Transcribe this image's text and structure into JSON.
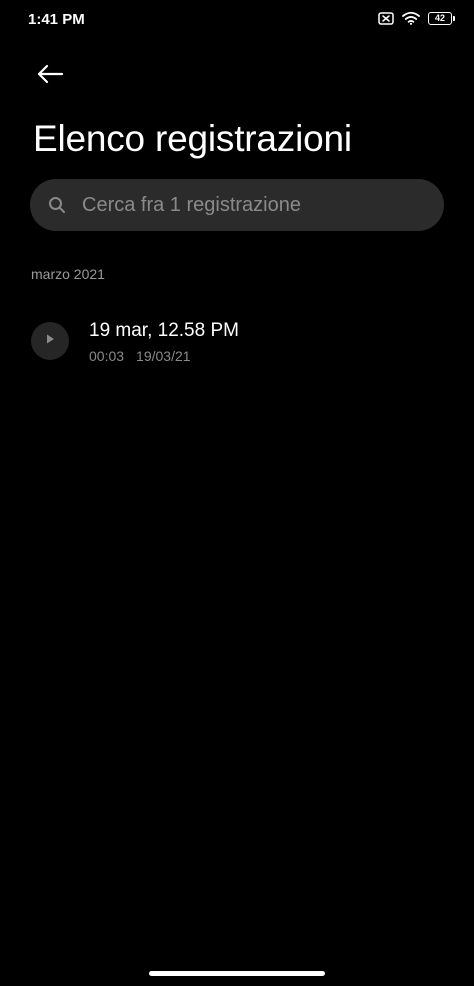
{
  "status_bar": {
    "time": "1:41 PM",
    "battery_level": "42",
    "icons": [
      "sim-disabled-icon",
      "wifi-icon",
      "battery-icon"
    ]
  },
  "header": {
    "back_icon": "arrow-left-icon",
    "title": "Elenco registrazioni"
  },
  "search": {
    "placeholder": "Cerca fra 1 registrazione",
    "value": "",
    "icon": "search-icon"
  },
  "sections": [
    {
      "header": "marzo 2021",
      "items": [
        {
          "title": "19 mar, 12.58 PM",
          "duration": "00:03",
          "date": "19/03/21",
          "icon": "play-icon"
        }
      ]
    }
  ],
  "colors": {
    "background": "#000000",
    "search_background": "#2b2b2b",
    "secondary_text": "#8a8a8a",
    "play_button_background": "#262626"
  }
}
